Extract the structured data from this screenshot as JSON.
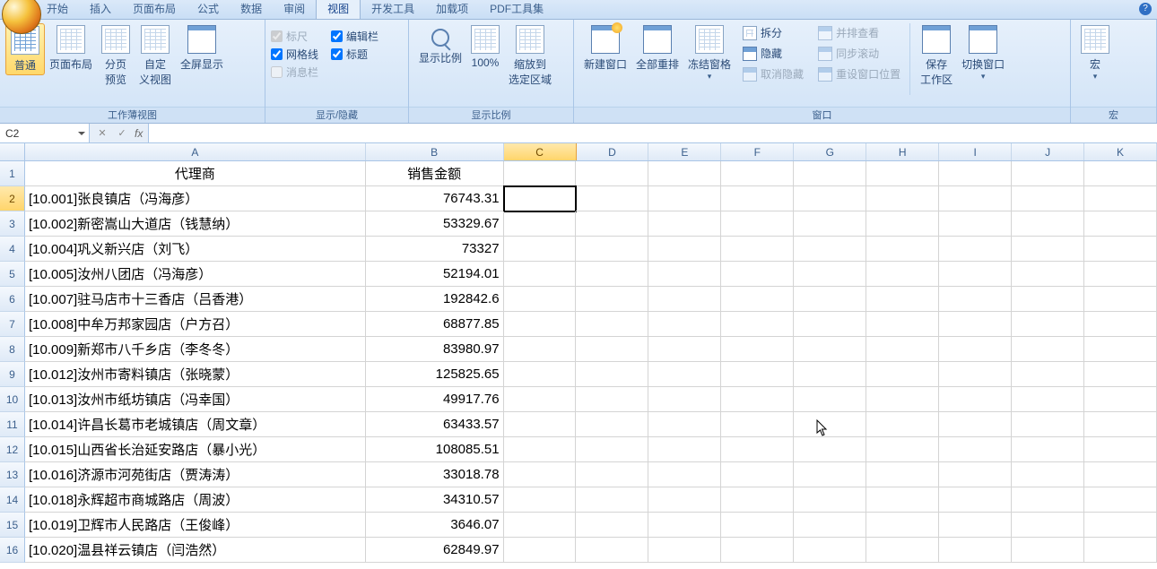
{
  "tabs": {
    "start": "开始",
    "insert": "插入",
    "layout": "页面布局",
    "formula": "公式",
    "data": "数据",
    "review": "审阅",
    "view": "视图",
    "dev": "开发工具",
    "addin": "加载项",
    "pdf": "PDF工具集"
  },
  "ribbon": {
    "views": {
      "normal": "普通",
      "pageLayout": "页面布局",
      "pageBreak1": "分页",
      "pageBreak2": "预览",
      "custom1": "自定",
      "custom2": "义视图",
      "fullscreen": "全屏显示",
      "groupLabel": "工作薄视图"
    },
    "show": {
      "ruler": "标尺",
      "formulaBar": "编辑栏",
      "gridlines": "网格线",
      "headings": "标题",
      "messageBar": "消息栏",
      "groupLabel": "显示/隐藏"
    },
    "zoom": {
      "zoom": "显示比例",
      "hundred": "100%",
      "toSelection1": "缩放到",
      "toSelection2": "选定区域",
      "groupLabel": "显示比例"
    },
    "window": {
      "newWindow": "新建窗口",
      "arrange": "全部重排",
      "freeze": "冻结窗格",
      "split": "拆分",
      "hide": "隐藏",
      "unhide": "取消隐藏",
      "sideBySide": "并排查看",
      "syncScroll": "同步滚动",
      "resetPos": "重设窗口位置",
      "saveWs1": "保存",
      "saveWs2": "工作区",
      "switch": "切换窗口",
      "groupLabel": "窗口"
    },
    "macros": {
      "macro": "宏",
      "groupLabel": "宏"
    }
  },
  "namebox": "C2",
  "headers": {
    "A": "代理商",
    "B": "销售金额"
  },
  "columns": [
    "A",
    "B",
    "C",
    "D",
    "E",
    "F",
    "G",
    "H",
    "I",
    "J",
    "K"
  ],
  "data": [
    {
      "a": "[10.001]张良镇店（冯海彦）",
      "b": "76743.31"
    },
    {
      "a": "[10.002]新密嵩山大道店（钱慧纳）",
      "b": "53329.67"
    },
    {
      "a": "[10.004]巩义新兴店（刘飞）",
      "b": "73327"
    },
    {
      "a": "[10.005]汝州八团店（冯海彦）",
      "b": "52194.01"
    },
    {
      "a": "[10.007]驻马店市十三香店（吕香港）",
      "b": "192842.6"
    },
    {
      "a": "[10.008]中牟万邦家园店（户方召）",
      "b": "68877.85"
    },
    {
      "a": "[10.009]新郑市八千乡店（李冬冬）",
      "b": "83980.97"
    },
    {
      "a": "[10.012]汝州市寄料镇店（张晓蒙）",
      "b": "125825.65"
    },
    {
      "a": "[10.013]汝州市纸坊镇店（冯幸国）",
      "b": "49917.76"
    },
    {
      "a": "[10.014]许昌长葛市老城镇店（周文章）",
      "b": "63433.57"
    },
    {
      "a": "[10.015]山西省长治延安路店（暴小光）",
      "b": "108085.51"
    },
    {
      "a": "[10.016]济源市河苑街店（贾涛涛）",
      "b": "33018.78"
    },
    {
      "a": "[10.018]永辉超市商城路店（周波）",
      "b": "34310.57"
    },
    {
      "a": "[10.019]卫辉市人民路店（王俊峰）",
      "b": "3646.07"
    },
    {
      "a": "[10.020]温县祥云镇店（闫浩然）",
      "b": "62849.97"
    }
  ]
}
